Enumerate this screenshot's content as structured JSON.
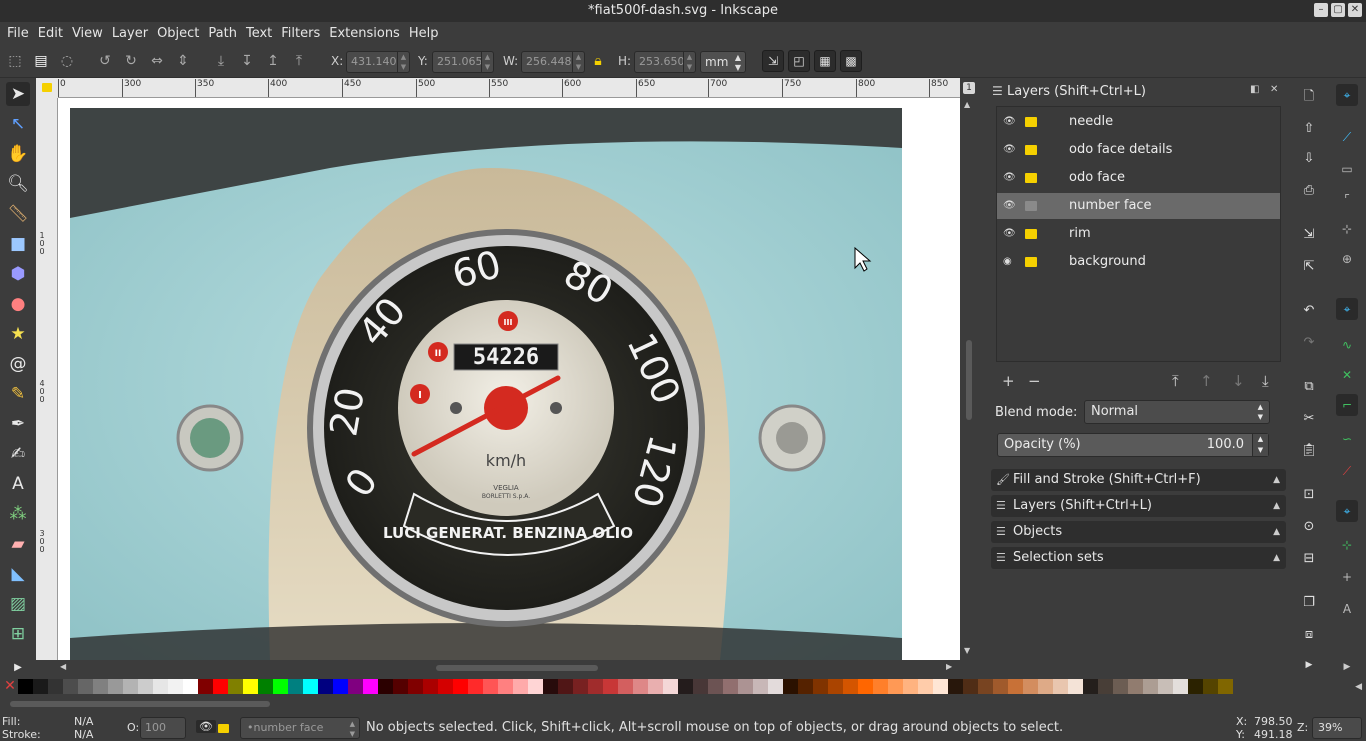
{
  "window": {
    "title": "*fiat500f-dash.svg - Inkscape"
  },
  "menu": [
    "File",
    "Edit",
    "View",
    "Layer",
    "Object",
    "Path",
    "Text",
    "Filters",
    "Extensions",
    "Help"
  ],
  "toolbar": {
    "x_label": "X:",
    "x_value": "431.140",
    "y_label": "Y:",
    "y_value": "251.065",
    "w_label": "W:",
    "w_value": "256.448",
    "h_label": "H:",
    "h_value": "253.650",
    "unit": "mm"
  },
  "ruler": {
    "h_ticks": [
      "0",
      "300",
      "350",
      "400",
      "450",
      "500",
      "550",
      "600",
      "650",
      "700",
      "750",
      "800",
      "850"
    ]
  },
  "canvas": {
    "odometer": "54226",
    "speed_labels": [
      "0",
      "20",
      "40",
      "60",
      "80",
      "100",
      "120"
    ],
    "unit_text": "km/h",
    "brand_1": "VEGLIA",
    "brand_2": "BORLETTI S.p.A.",
    "arc_text": "LUCI GENERAT. BENZINA OLIO",
    "lights_1": "I",
    "lights_2": "II",
    "lights_3": "III"
  },
  "layers_panel": {
    "title": "Layers (Shift+Ctrl+L)",
    "layers": [
      {
        "name": "needle",
        "selected": false
      },
      {
        "name": "odo face details",
        "selected": false
      },
      {
        "name": "odo face",
        "selected": false
      },
      {
        "name": "number face",
        "selected": true
      },
      {
        "name": "rim",
        "selected": false
      },
      {
        "name": "background",
        "selected": false
      }
    ],
    "blend_label": "Blend mode:",
    "blend_value": "Normal",
    "opacity_label": "Opacity (%)",
    "opacity_value": "100.0"
  },
  "docks": [
    {
      "label": "Fill and Stroke (Shift+Ctrl+F)"
    },
    {
      "label": "Layers (Shift+Ctrl+L)"
    },
    {
      "label": "Objects"
    },
    {
      "label": "Selection sets"
    }
  ],
  "status": {
    "fill_label": "Fill:",
    "fill_value": "N/A",
    "stroke_label": "Stroke:",
    "stroke_value": "N/A",
    "opacity_label": "O:",
    "opacity_value": "100",
    "layer": "•number face",
    "message": "No objects selected. Click, Shift+click, Alt+scroll mouse on top of objects, or drag around objects to select.",
    "x_label": "X:",
    "x_value": "798.50",
    "y_label": "Y:",
    "y_value": "491.18",
    "zoom_label": "Z:",
    "zoom_value": "39%"
  },
  "palette": [
    "#000000",
    "#1a1a1a",
    "#333333",
    "#4d4d4d",
    "#666666",
    "#808080",
    "#999999",
    "#b3b3b3",
    "#cccccc",
    "#e6e6e6",
    "#f2f2f2",
    "#ffffff",
    "#800000",
    "#ff0000",
    "#808000",
    "#ffff00",
    "#008000",
    "#00ff00",
    "#008080",
    "#00ffff",
    "#000080",
    "#0000ff",
    "#800080",
    "#ff00ff",
    "#2b0000",
    "#550000",
    "#800000",
    "#aa0000",
    "#d40000",
    "#ff0000",
    "#ff2a2a",
    "#ff5555",
    "#ff8080",
    "#ffaaaa",
    "#ffd5d5",
    "#280b0b",
    "#501616",
    "#782121",
    "#a02c2c",
    "#c83737",
    "#d35f5f",
    "#de8787",
    "#e9afaf",
    "#f4d7d7",
    "#241c1c",
    "#483737",
    "#6c5353",
    "#916f6f",
    "#ac9393",
    "#c8b7b7",
    "#e3dbdb",
    "#2b1100",
    "#552200",
    "#803300",
    "#aa4400",
    "#d45500",
    "#ff6600",
    "#ff7f2a",
    "#ff9955",
    "#ffb380",
    "#ffccaa",
    "#ffe6d5",
    "#28170b",
    "#502d16",
    "#784421",
    "#a05a2c",
    "#c87137",
    "#d38d5f",
    "#deaa87",
    "#e9c6af",
    "#f4e3d7",
    "#241f1c",
    "#483e37",
    "#6c5d53",
    "#917c6f",
    "#ac9d93",
    "#c8beb7",
    "#e3dedb",
    "#2b2200",
    "#554400",
    "#806600"
  ]
}
